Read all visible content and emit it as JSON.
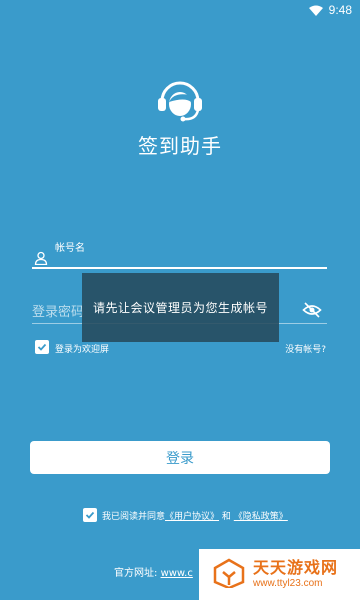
{
  "status_bar": {
    "time": "9:48"
  },
  "app": {
    "title": "签到助手"
  },
  "account_field": {
    "label": "帐号名",
    "value": ""
  },
  "password_field": {
    "placeholder": "登录密码"
  },
  "toast": {
    "message": "请先让会议管理员为您生成帐号"
  },
  "welcome_option": {
    "label": "登录为欢迎屏",
    "checked": true
  },
  "no_account_link": "没有帐号?",
  "login_button": "登录",
  "agreement": {
    "checked": true,
    "prefix": "我已阅读并同意",
    "user_agreement": "《用户协议》",
    "and": "和",
    "privacy_policy": "《隐私政策》"
  },
  "official_site": {
    "label": "官方网址:",
    "url": "www.c"
  },
  "watermark": {
    "brand": "天天游戏网",
    "site": "www.ttyl23.com"
  },
  "colors": {
    "background": "#3a9bcb",
    "button_text": "#3a9bcb",
    "watermark": "#e8721a"
  }
}
